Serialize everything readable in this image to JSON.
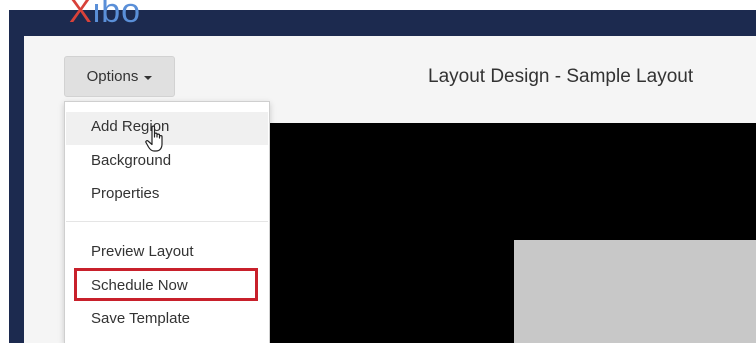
{
  "app": {
    "logo_text_x": "X",
    "logo_text_rest": "ibo"
  },
  "toolbar": {
    "options_label": "Options"
  },
  "page": {
    "title": "Layout Design - Sample Layout"
  },
  "options_menu": {
    "items": [
      {
        "label": "Add Region"
      },
      {
        "label": "Background"
      },
      {
        "label": "Properties"
      },
      {
        "label": "Preview Layout"
      },
      {
        "label": "Schedule Now"
      },
      {
        "label": "Save Template"
      }
    ]
  },
  "colors": {
    "header_bg": "#1c2a4f",
    "highlight_border": "#c8202b",
    "canvas_bg": "#000000",
    "region_bg": "#c8c8c8"
  },
  "icons": {
    "cursor": "hand-pointer-icon",
    "dropdown": "caret-down-icon"
  }
}
